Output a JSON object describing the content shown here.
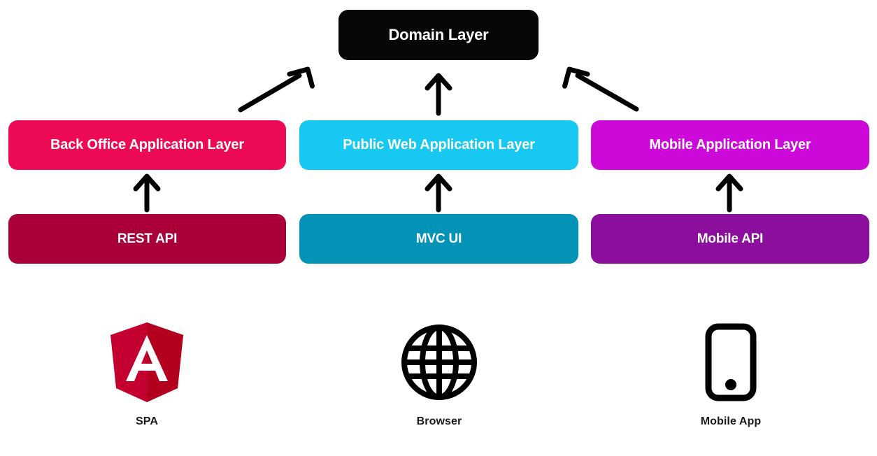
{
  "diagram": {
    "title_box": {
      "label": "Domain Layer",
      "color": "#070707"
    },
    "application_layers": [
      {
        "label": "Back Office Application Layer",
        "color": "#ED0A55"
      },
      {
        "label": "Public Web Application Layer",
        "color": "#16C8F2"
      },
      {
        "label": "Mobile Application Layer",
        "color": "#CD09D9"
      }
    ],
    "interface_layers": [
      {
        "label": "REST API",
        "color": "#A90039"
      },
      {
        "label": "MVC UI",
        "color": "#0393B7"
      },
      {
        "label": "Mobile API",
        "color": "#8B0E9C"
      }
    ],
    "clients": [
      {
        "label": "SPA",
        "icon": "angular-logo-icon",
        "color": "#C3002F"
      },
      {
        "label": "Browser",
        "icon": "globe-icon",
        "color": "#000000"
      },
      {
        "label": "Mobile App",
        "icon": "smartphone-icon",
        "color": "#000000"
      }
    ],
    "arrows": [
      {
        "name": "arrow-backoffice-to-domain",
        "direction": "up-right",
        "color": "#000000"
      },
      {
        "name": "arrow-publicweb-to-domain",
        "direction": "up",
        "color": "#000000"
      },
      {
        "name": "arrow-mobile-to-domain",
        "direction": "up-left",
        "color": "#000000"
      },
      {
        "name": "arrow-restapi-to-backoffice",
        "direction": "up",
        "color": "#000000"
      },
      {
        "name": "arrow-mvcui-to-publicweb",
        "direction": "up",
        "color": "#000000"
      },
      {
        "name": "arrow-mobileapi-to-mobile",
        "direction": "up",
        "color": "#000000"
      }
    ],
    "background": "#ffffff"
  }
}
